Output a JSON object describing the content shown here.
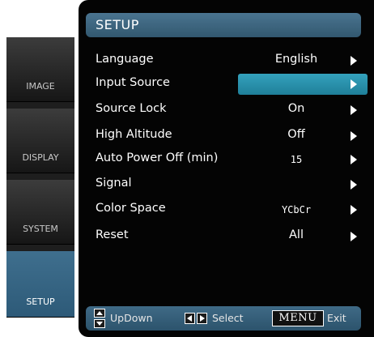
{
  "tabs": [
    {
      "label": "IMAGE",
      "active": false
    },
    {
      "label": "DISPLAY",
      "active": false
    },
    {
      "label": "SYSTEM",
      "active": false
    },
    {
      "label": "SETUP",
      "active": true
    }
  ],
  "header": {
    "title": "SETUP"
  },
  "rows": [
    {
      "label": "Language",
      "value": "English"
    },
    {
      "label": "Input Source",
      "value": "",
      "highlighted": true
    },
    {
      "label": "Source Lock",
      "value": "On"
    },
    {
      "label": "High Altitude",
      "value": "Off"
    },
    {
      "label": "Auto Power Off (min)",
      "value": "15"
    },
    {
      "label": "Signal",
      "value": ""
    },
    {
      "label": "Color Space",
      "value": "YCbCr"
    },
    {
      "label": "Reset",
      "value": "All"
    }
  ],
  "footer": {
    "updown_label": "UpDown",
    "select_label": "Select",
    "menu_key": "MENU",
    "exit_label": "Exit"
  },
  "colors": {
    "highlight": "#2a93ad",
    "header": "#3f6a86",
    "active_tab": "#34617f"
  }
}
